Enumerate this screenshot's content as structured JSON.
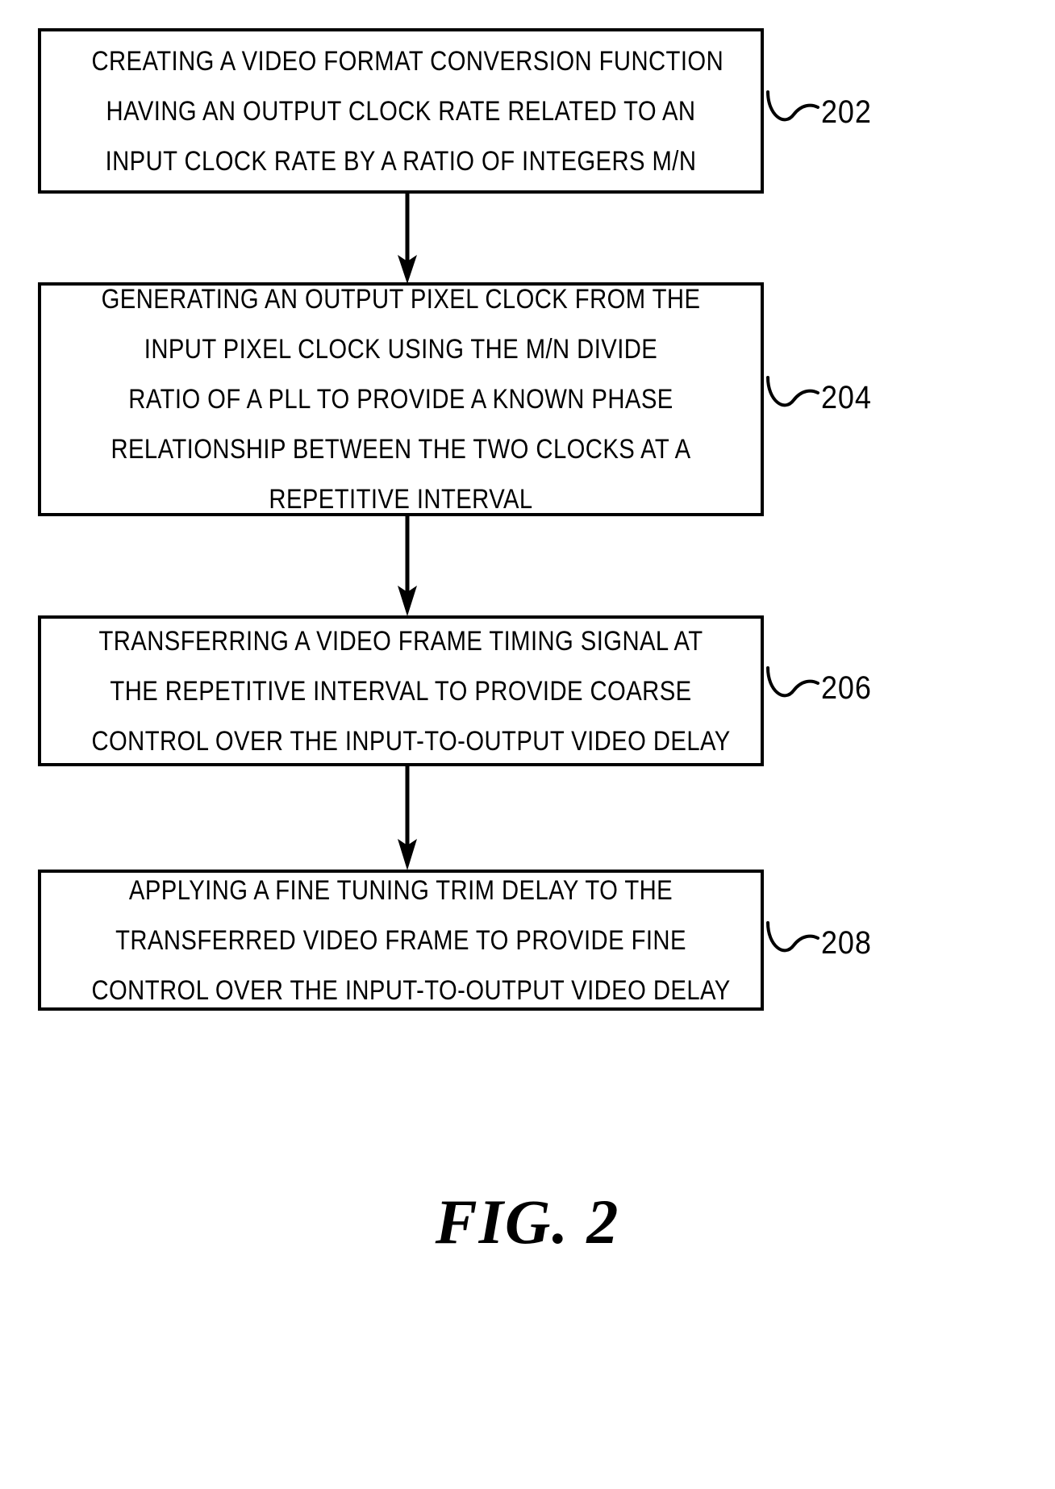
{
  "figure": {
    "caption_label": "FIG.",
    "caption_number": "2"
  },
  "steps": [
    {
      "ref": "202",
      "lines": [
        "CREATING A VIDEO FORMAT CONVERSION FUNCTION",
        "HAVING AN OUTPUT CLOCK RATE RELATED TO AN",
        "INPUT CLOCK RATE BY A RATIO OF INTEGERS M/N"
      ]
    },
    {
      "ref": "204",
      "lines": [
        "GENERATING AN OUTPUT PIXEL CLOCK FROM THE",
        "INPUT PIXEL CLOCK USING THE M/N DIVIDE",
        "RATIO OF A PLL TO PROVIDE A KNOWN PHASE",
        "RELATIONSHIP BETWEEN THE TWO CLOCKS AT A",
        "REPETITIVE INTERVAL"
      ]
    },
    {
      "ref": "206",
      "lines": [
        "TRANSFERRING A VIDEO FRAME TIMING SIGNAL AT",
        "THE REPETITIVE INTERVAL TO PROVIDE COARSE",
        "CONTROL OVER THE INPUT-TO-OUTPUT VIDEO DELAY"
      ]
    },
    {
      "ref": "208",
      "lines": [
        "APPLYING A FINE TUNING TRIM DELAY TO THE",
        "TRANSFERRED VIDEO FRAME TO PROVIDE FINE",
        "CONTROL OVER THE INPUT-TO-OUTPUT VIDEO DELAY"
      ]
    }
  ],
  "colors": {
    "ink": "#000000",
    "paper": "#ffffff"
  }
}
